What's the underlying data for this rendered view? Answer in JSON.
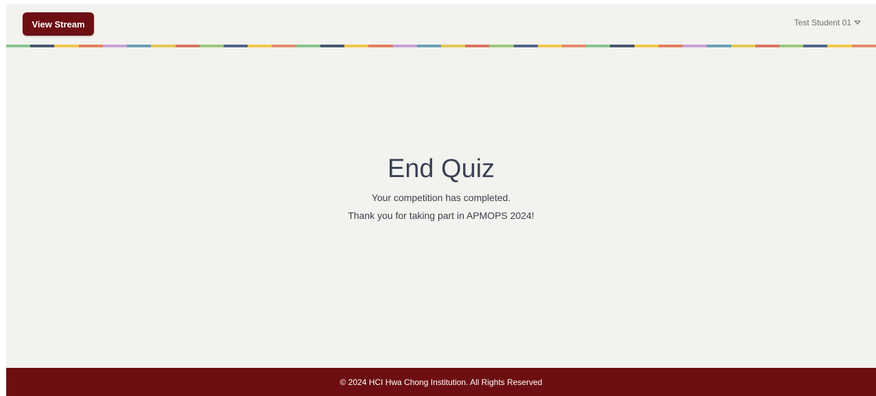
{
  "header": {
    "view_stream_label": "View Stream",
    "user_name": "Test Student 01",
    "accent_color": "#6d0f12",
    "stripe_colors": [
      "#86c48c",
      "#46566e",
      "#f0c64a",
      "#e27e5c",
      "#c9a0d8",
      "#6aa0b8",
      "#e4c850",
      "#d9745f",
      "#9cc87a",
      "#50648a",
      "#f2c84a",
      "#e48a6a"
    ]
  },
  "main": {
    "title": "End Quiz",
    "message_line1": "Your competition has completed.",
    "message_line2": "Thank you for taking part in APMOPS 2024!"
  },
  "footer": {
    "text": "© 2024 HCI Hwa Chong Institution. All Rights Reserved"
  }
}
